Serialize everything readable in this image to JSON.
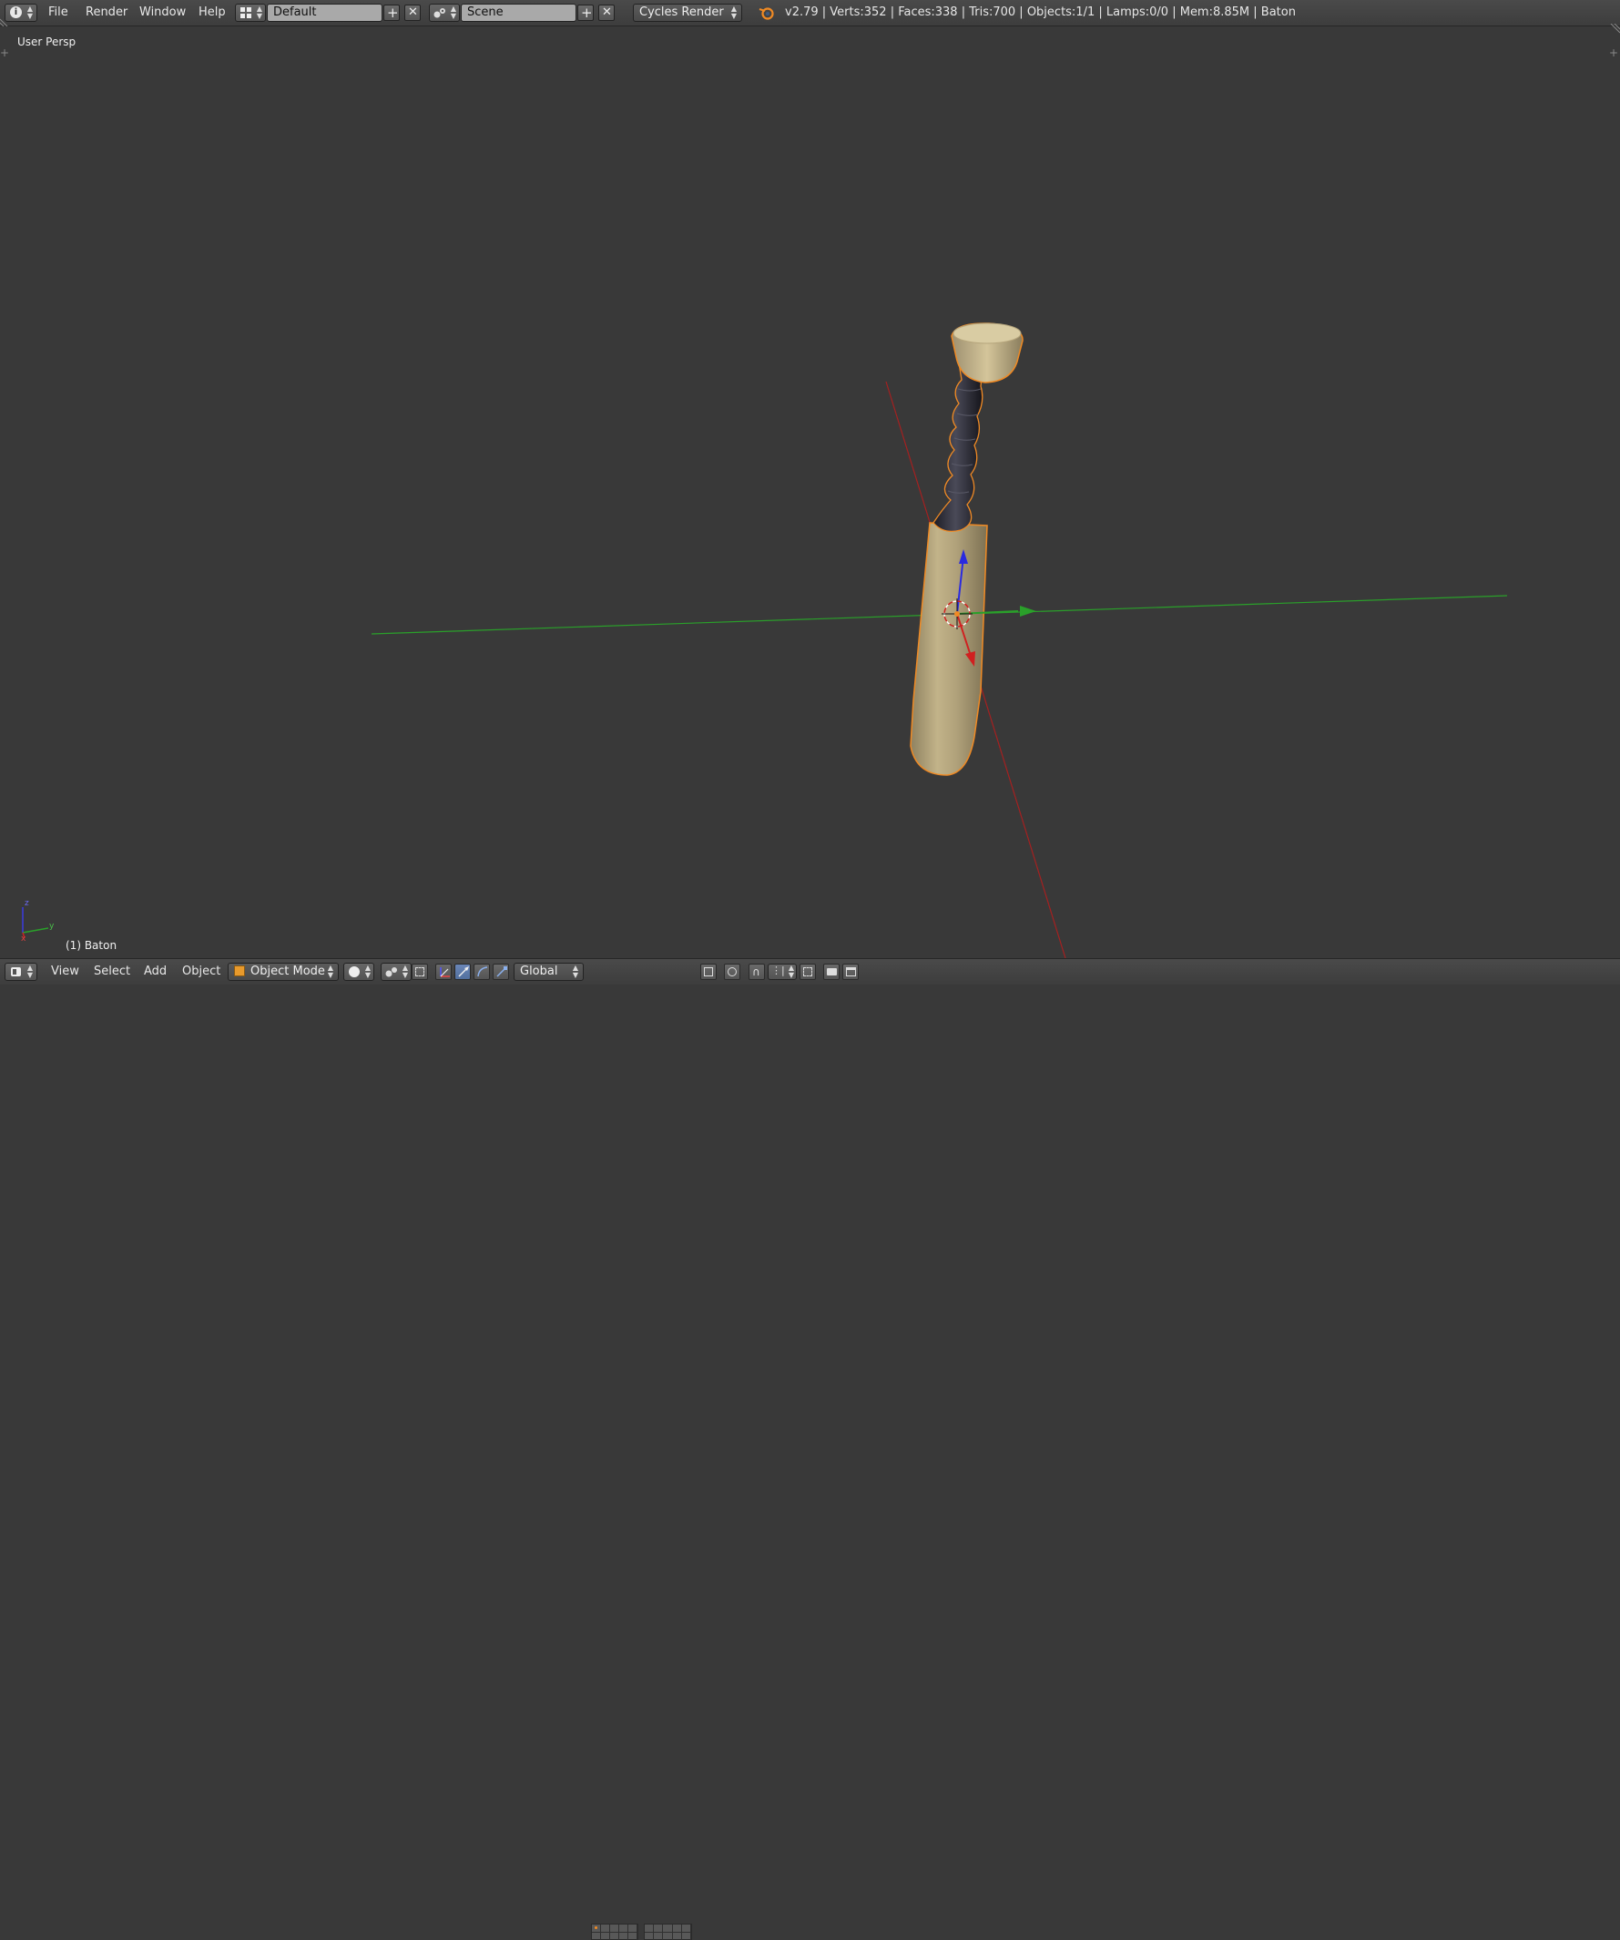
{
  "header": {
    "menus": [
      "File",
      "Render",
      "Window",
      "Help"
    ],
    "screen_layout": "Default",
    "scene": "Scene",
    "render_engine": "Cycles Render",
    "status": "v2.79 | Verts:352 | Faces:338 | Tris:700 | Objects:1/1 | Lamps:0/0 | Mem:8.85M | Baton"
  },
  "viewport": {
    "view_label": "User Persp",
    "object_label": "(1) Baton",
    "axis_labels": {
      "z": "z",
      "y": "y",
      "x": "x"
    }
  },
  "footer": {
    "menus": [
      "View",
      "Select",
      "Add",
      "Object"
    ],
    "mode": "Object Mode",
    "orientation": "Global"
  },
  "colors": {
    "background": "#393939",
    "header": "#444444",
    "x_axis": "#c02020",
    "y_axis": "#22a022",
    "z_axis": "#2020e0",
    "selection_outline": "#f08a24",
    "baton_body": "#b5a57c",
    "baton_grip": "#2c2c36"
  }
}
